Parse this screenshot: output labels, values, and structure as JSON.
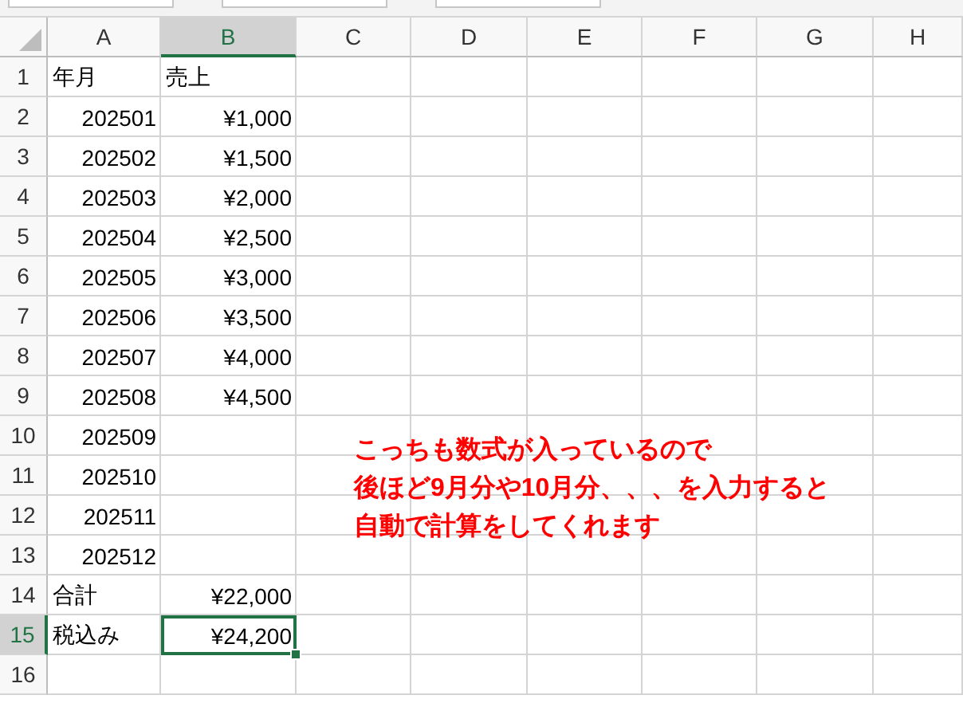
{
  "columns": [
    {
      "label": "A",
      "selected": false
    },
    {
      "label": "B",
      "selected": true
    },
    {
      "label": "C",
      "selected": false
    },
    {
      "label": "D",
      "selected": false
    },
    {
      "label": "E",
      "selected": false
    },
    {
      "label": "F",
      "selected": false
    },
    {
      "label": "G",
      "selected": false
    },
    {
      "label": "H",
      "selected": false
    }
  ],
  "rows": [
    {
      "header": "1",
      "selected": false,
      "cells": [
        {
          "kind": "text",
          "text": "年月",
          "selected": false
        },
        {
          "kind": "text",
          "text": "売上",
          "selected": false
        }
      ]
    },
    {
      "header": "2",
      "selected": false,
      "cells": [
        {
          "kind": "number",
          "text": "202501",
          "selected": false
        },
        {
          "kind": "number",
          "text": "¥1,000",
          "selected": false
        }
      ]
    },
    {
      "header": "3",
      "selected": false,
      "cells": [
        {
          "kind": "number",
          "text": "202502",
          "selected": false
        },
        {
          "kind": "number",
          "text": "¥1,500",
          "selected": false
        }
      ]
    },
    {
      "header": "4",
      "selected": false,
      "cells": [
        {
          "kind": "number",
          "text": "202503",
          "selected": false
        },
        {
          "kind": "number",
          "text": "¥2,000",
          "selected": false
        }
      ]
    },
    {
      "header": "5",
      "selected": false,
      "cells": [
        {
          "kind": "number",
          "text": "202504",
          "selected": false
        },
        {
          "kind": "number",
          "text": "¥2,500",
          "selected": false
        }
      ]
    },
    {
      "header": "6",
      "selected": false,
      "cells": [
        {
          "kind": "number",
          "text": "202505",
          "selected": false
        },
        {
          "kind": "number",
          "text": "¥3,000",
          "selected": false
        }
      ]
    },
    {
      "header": "7",
      "selected": false,
      "cells": [
        {
          "kind": "number",
          "text": "202506",
          "selected": false
        },
        {
          "kind": "number",
          "text": "¥3,500",
          "selected": false
        }
      ]
    },
    {
      "header": "8",
      "selected": false,
      "cells": [
        {
          "kind": "number",
          "text": "202507",
          "selected": false
        },
        {
          "kind": "number",
          "text": "¥4,000",
          "selected": false
        }
      ]
    },
    {
      "header": "9",
      "selected": false,
      "cells": [
        {
          "kind": "number",
          "text": "202508",
          "selected": false
        },
        {
          "kind": "number",
          "text": "¥4,500",
          "selected": false
        }
      ]
    },
    {
      "header": "10",
      "selected": false,
      "cells": [
        {
          "kind": "number",
          "text": "202509",
          "selected": false
        },
        {
          "kind": "empty",
          "selected": false
        }
      ]
    },
    {
      "header": "11",
      "selected": false,
      "cells": [
        {
          "kind": "number",
          "text": "202510",
          "selected": false
        },
        {
          "kind": "empty",
          "selected": false
        }
      ]
    },
    {
      "header": "12",
      "selected": false,
      "cells": [
        {
          "kind": "number",
          "text": "202511",
          "selected": false
        },
        {
          "kind": "empty",
          "selected": false
        }
      ]
    },
    {
      "header": "13",
      "selected": false,
      "cells": [
        {
          "kind": "number",
          "text": "202512",
          "selected": false
        },
        {
          "kind": "empty",
          "selected": false
        }
      ]
    },
    {
      "header": "14",
      "selected": false,
      "cells": [
        {
          "kind": "text",
          "text": "合計",
          "selected": false
        },
        {
          "kind": "number",
          "text": "¥22,000",
          "selected": false
        }
      ]
    },
    {
      "header": "15",
      "selected": true,
      "cells": [
        {
          "kind": "text",
          "text": "税込み",
          "selected": false
        },
        {
          "kind": "number",
          "text": "¥24,200",
          "selected": true
        }
      ]
    },
    {
      "header": "16",
      "selected": false,
      "cells": [
        {
          "kind": "empty",
          "selected": false
        },
        {
          "kind": "empty",
          "selected": false
        }
      ]
    }
  ],
  "note": {
    "lines": [
      "こっちも数式が入っているので",
      "後ほど9月分や10月分、、、を入力すると",
      "自動で計算をしてくれます"
    ]
  }
}
